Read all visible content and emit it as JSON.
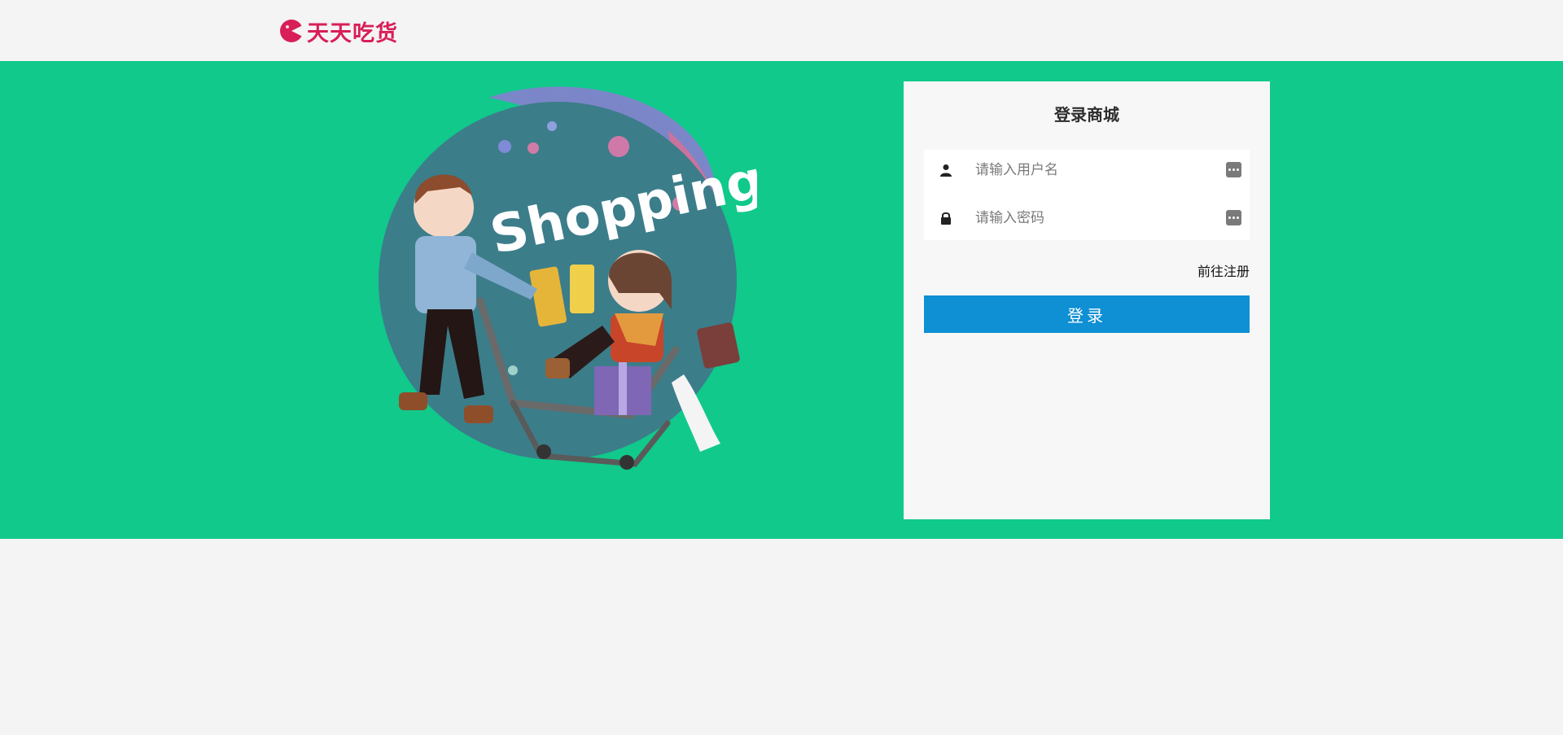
{
  "brand": {
    "name": "天天吃货",
    "logo_color": "#d81f58"
  },
  "hero": {
    "image_text": "Shopping"
  },
  "login": {
    "title": "登录商城",
    "username_placeholder": "请输入用户名",
    "password_placeholder": "请输入密码",
    "register_link": "前往注册",
    "submit_label": "登录"
  },
  "colors": {
    "banner": "#10c98b",
    "primary_button": "#0f8fd4",
    "card": "#f7f7f7",
    "page_background": "#f4f4f4"
  },
  "icons": {
    "username": "user-icon",
    "password": "lock-icon",
    "autofill": "autofill-dots-icon"
  }
}
